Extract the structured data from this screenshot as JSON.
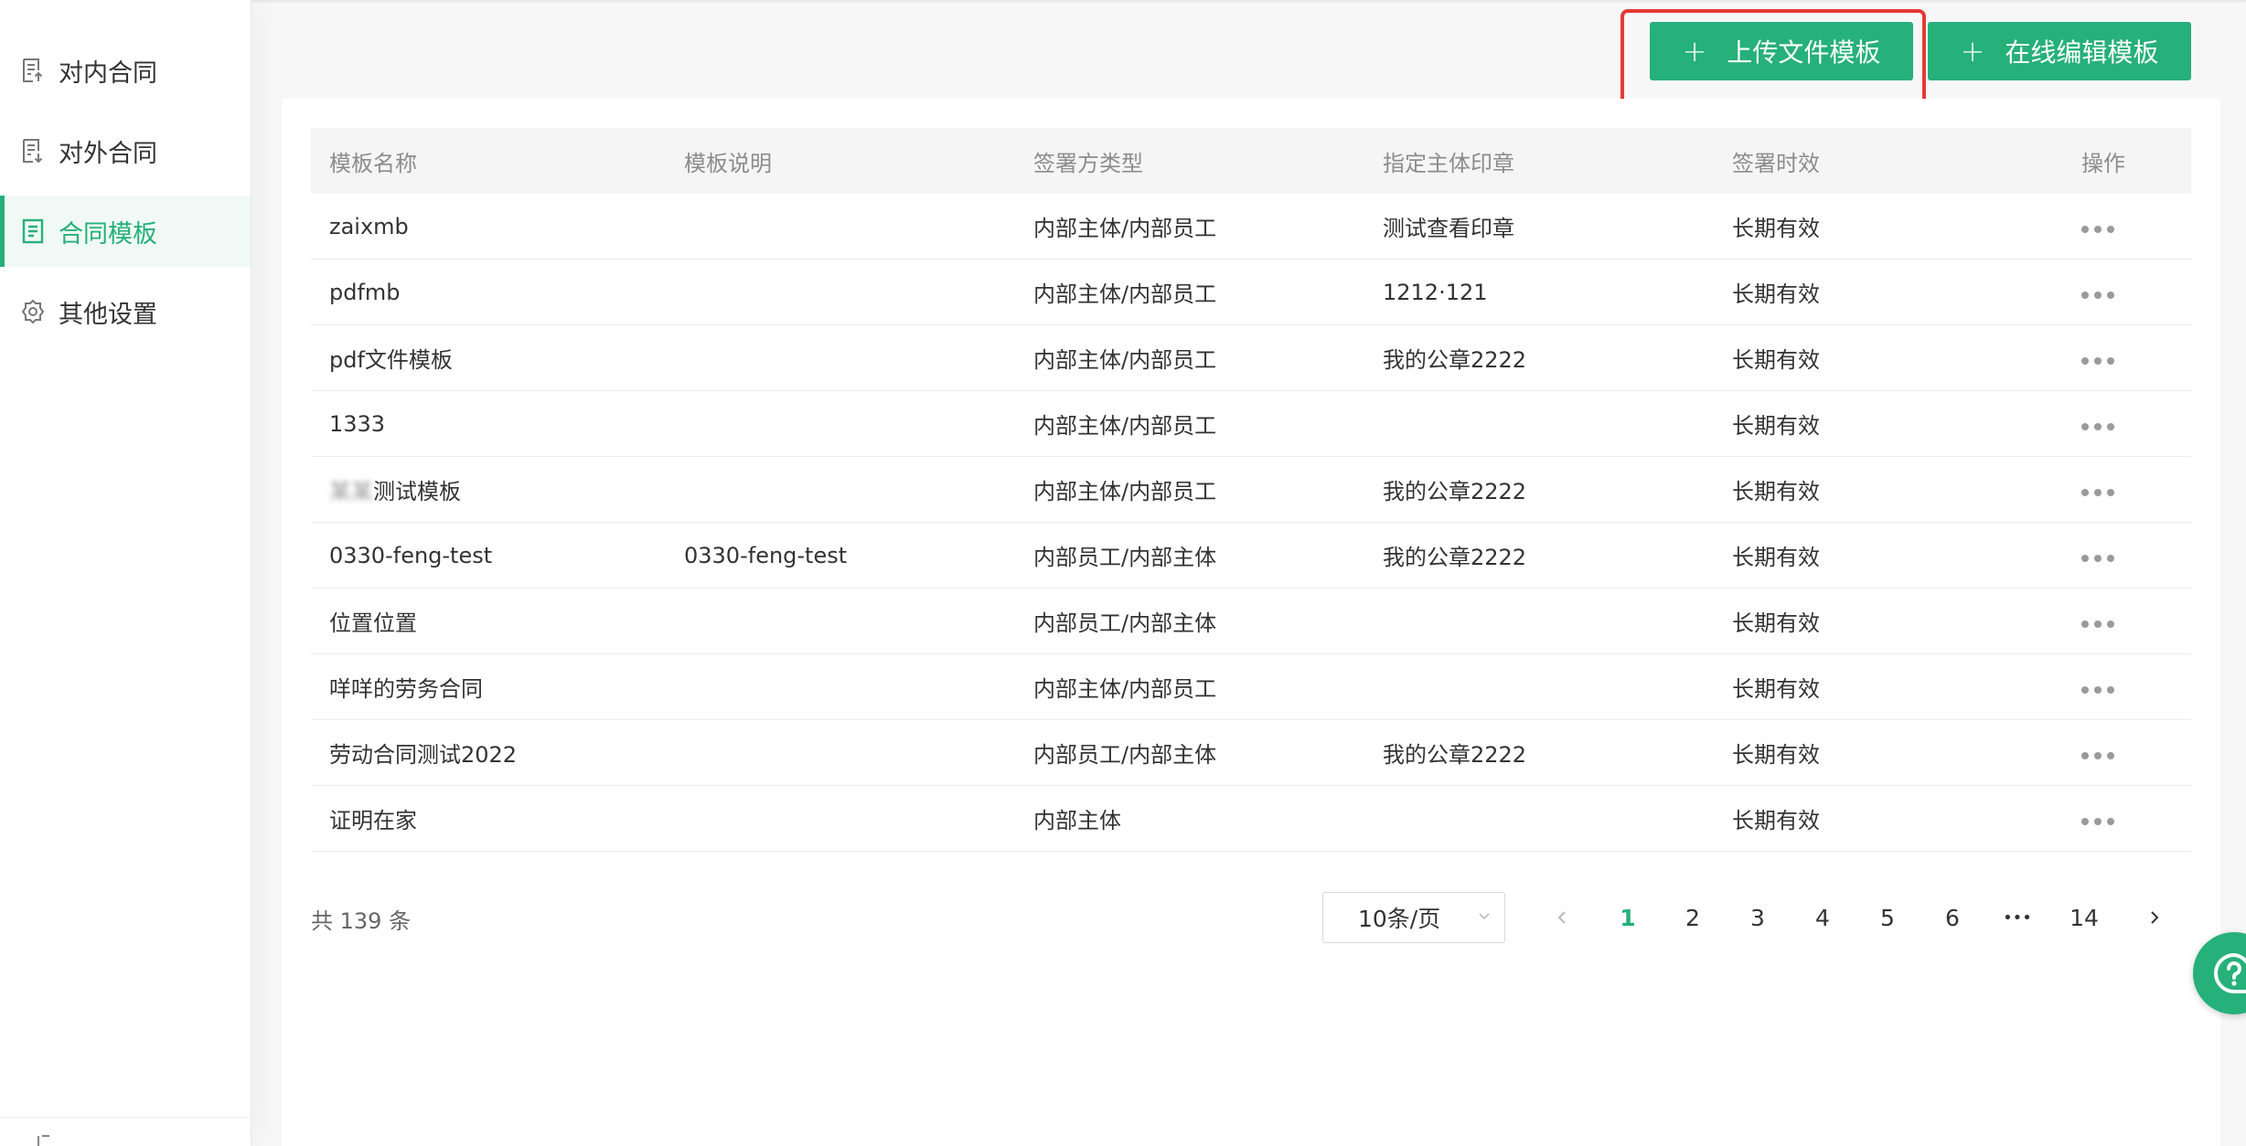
{
  "sidebar": {
    "items": [
      {
        "label": "对内合同",
        "icon": "document-in-icon"
      },
      {
        "label": "对外合同",
        "icon": "document-out-icon"
      },
      {
        "label": "合同模板",
        "icon": "template-icon",
        "active": true
      },
      {
        "label": "其他设置",
        "icon": "gear-icon"
      }
    ]
  },
  "toolbar": {
    "upload_label": "上传文件模板",
    "edit_label": "在线编辑模板",
    "plus": "+"
  },
  "table": {
    "headers": [
      "模板名称",
      "模板说明",
      "签署方类型",
      "指定主体印章",
      "签署时效",
      "操作"
    ],
    "rows": [
      {
        "name": "zaixmb",
        "desc": "",
        "type": "内部主体/内部员工",
        "seal": "测试查看印章",
        "validity": "长期有效"
      },
      {
        "name": "pdfmb",
        "desc": "",
        "type": "内部主体/内部员工",
        "seal": "1212·121",
        "validity": "长期有效"
      },
      {
        "name": "pdf文件模板",
        "desc": "",
        "type": "内部主体/内部员工",
        "seal": "我的公章2222",
        "validity": "长期有效"
      },
      {
        "name": "1333",
        "desc": "",
        "type": "内部主体/内部员工",
        "seal": "",
        "validity": "长期有效"
      },
      {
        "name": "测试模板",
        "name_blurred_prefix": "某某",
        "desc": "",
        "type": "内部主体/内部员工",
        "seal": "我的公章2222",
        "validity": "长期有效"
      },
      {
        "name": "0330-feng-test",
        "desc": "0330-feng-test",
        "type": "内部员工/内部主体",
        "seal": "我的公章2222",
        "validity": "长期有效"
      },
      {
        "name": "位置位置",
        "desc": "",
        "type": "内部员工/内部主体",
        "seal": "",
        "validity": "长期有效"
      },
      {
        "name": "咩咩的劳务合同",
        "desc": "",
        "type": "内部主体/内部员工",
        "seal": "",
        "validity": "长期有效"
      },
      {
        "name": "劳动合同测试2022",
        "desc": "",
        "type": "内部员工/内部主体",
        "seal": "我的公章2222",
        "validity": "长期有效"
      },
      {
        "name": "证明在家",
        "desc": "",
        "type": "内部主体",
        "seal": "",
        "validity": "长期有效"
      }
    ]
  },
  "pagination": {
    "total_text": "共 139 条",
    "page_size": "10条/页",
    "pages": [
      "1",
      "2",
      "3",
      "4",
      "5",
      "6",
      "•••",
      "14"
    ],
    "current": "1"
  },
  "colors": {
    "accent": "#26b07a",
    "highlight": "#e53935"
  }
}
